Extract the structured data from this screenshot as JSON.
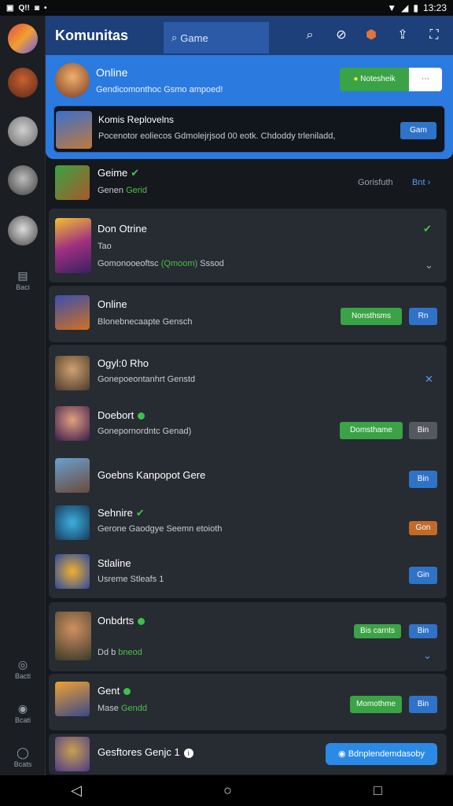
{
  "status_bar": {
    "time": "13:23",
    "left_items": [
      "Q!!"
    ]
  },
  "header": {
    "title": "Komunitas",
    "search_placeholder": "Game"
  },
  "sidebar": {
    "labels": [
      "Baci",
      "Bacti",
      "Bcati",
      "Bcats"
    ]
  },
  "featured": {
    "top": {
      "name": "Online",
      "sub": "Gendicomonthoc Gsmo ampoed!",
      "button": "Notesheik"
    },
    "inner": {
      "name": "Komis Replovelns",
      "sub": "Pocenotor eoliecos Gdmolejrjsod 00 eotk. Chdoddy trleniladd,",
      "button": "Gam"
    }
  },
  "rows": [
    {
      "name": "Geime",
      "sub_prefix": "Genen ",
      "sub_green": "Gerid",
      "right_text": "Gorisfuth",
      "right_link": "Bnt"
    },
    {
      "name": "Don Otrine",
      "sub2": "Tao",
      "sub_prefix": "Gomonooeoftsc ",
      "sub_green": "(Qmoom)",
      "sub_suffix": " Sssod"
    },
    {
      "name": "Online",
      "sub": "Blonebnecaapte Gensch",
      "btn1": "Nonsthsms",
      "btn2": "Rn"
    },
    {
      "name": "Ogyl:0 Rho",
      "sub": "Gonepoeontanhrt Genstd"
    },
    {
      "name": "Doebort",
      "sub": "Gonepornordntc Genad)",
      "btn1": "Domsthame",
      "btn2": "Bin"
    },
    {
      "name": "Goebns Kanpopot Gere",
      "btn2": "Bin"
    },
    {
      "name": "Sehnire",
      "sub": "Gerone Gaodgye Seemn etoioth",
      "btn2": "Gon"
    },
    {
      "name": "Stlaline",
      "sub": "Usreme Stleafs 1",
      "btn2": "Gin"
    },
    {
      "name": "Onbdrts",
      "sub_prefix": "Dd b ",
      "sub_green": "bneod",
      "btn1": "Bis carnts",
      "btn2": "Bin"
    },
    {
      "name": "Gent",
      "sub_prefix": "Mase ",
      "sub_green": "Gendd",
      "btn1": "Momothme",
      "btn2": "Bin"
    },
    {
      "name": "Gesftores Genjc 1",
      "btn_wide": "Bdnplendemdasoby"
    }
  ],
  "colors": {
    "accent": "#2b7ae0",
    "green": "#3aa345",
    "topbar": "#1d3f7a"
  }
}
